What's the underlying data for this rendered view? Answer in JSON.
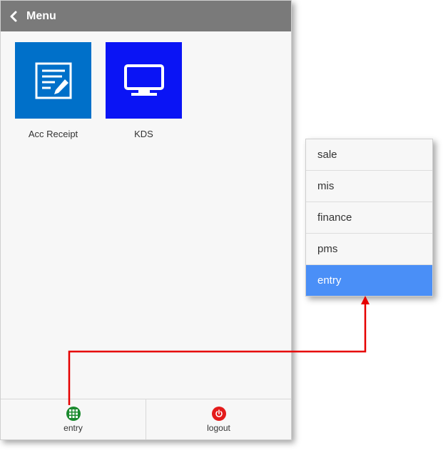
{
  "header": {
    "title": "Menu",
    "back_icon": "chevron-left-icon",
    "background": "#7a7a7a"
  },
  "tiles": [
    {
      "label": "Acc Receipt",
      "icon": "edit-document-icon",
      "color": "#0070c9"
    },
    {
      "label": "KDS",
      "icon": "monitor-icon",
      "color": "#0a14f5"
    }
  ],
  "footer": {
    "entry": {
      "label": "entry",
      "icon": "grid-icon",
      "color": "#1b8a2e"
    },
    "logout": {
      "label": "logout",
      "icon": "power-icon",
      "color": "#e41b1b"
    }
  },
  "popup": {
    "items": [
      "sale",
      "mis",
      "finance",
      "pms",
      "entry"
    ],
    "selected": "entry",
    "selected_color": "#4a8ff7"
  },
  "annotation": {
    "arrow_color": "#e60000"
  }
}
